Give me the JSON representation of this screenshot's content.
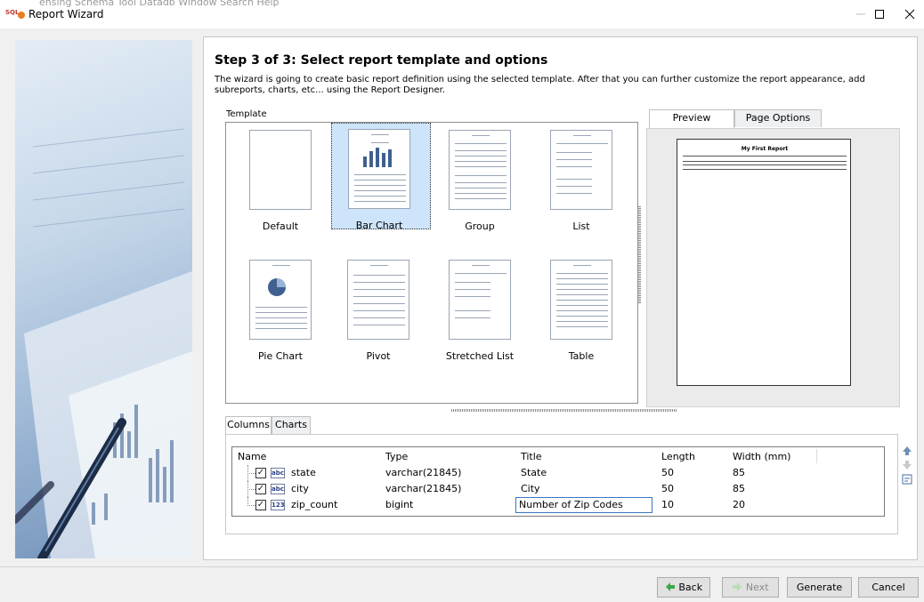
{
  "window": {
    "title": "Report Wizard",
    "ghost_menu": "ensing   Schema  Tool  Datadb  Window   Search   Help"
  },
  "step": {
    "title": "Step 3 of 3:  Select report template and options",
    "description": "The wizard is going to create basic report definition using the selected template. After that you can further customize the report appearance, add subreports, charts, etc... using the Report Designer."
  },
  "template": {
    "label": "Template",
    "selected": "Bar Chart",
    "items": [
      {
        "name": "Default"
      },
      {
        "name": "Bar Chart"
      },
      {
        "name": "Group"
      },
      {
        "name": "List"
      },
      {
        "name": "Pie Chart"
      },
      {
        "name": "Pivot"
      },
      {
        "name": "Stretched List"
      },
      {
        "name": "Table"
      }
    ]
  },
  "preview": {
    "tabs": [
      "Preview",
      "Page Options"
    ],
    "active_tab": "Preview",
    "page_title": "My First Report"
  },
  "columns": {
    "tabs": [
      "Columns",
      "Charts"
    ],
    "active_tab": "Columns",
    "headers": [
      "Name",
      "Type",
      "Title",
      "Length",
      "Width (mm)"
    ],
    "rows": [
      {
        "checked": true,
        "type_icon": "abc",
        "name": "state",
        "type": "varchar(21845)",
        "title": "State",
        "length": "50",
        "width": "85"
      },
      {
        "checked": true,
        "type_icon": "abc",
        "name": "city",
        "type": "varchar(21845)",
        "title": "City",
        "length": "50",
        "width": "85"
      },
      {
        "checked": true,
        "type_icon": "123",
        "name": "zip_count",
        "type": "bigint",
        "title": "Number of Zip Codes",
        "length": "10",
        "width": "20"
      }
    ]
  },
  "buttons": {
    "back": "Back",
    "next": "Next",
    "generate": "Generate",
    "cancel": "Cancel"
  },
  "colors": {
    "selection": "#cde4fb",
    "accent": "#3a76c4",
    "back_arrow": "#3aa844"
  }
}
